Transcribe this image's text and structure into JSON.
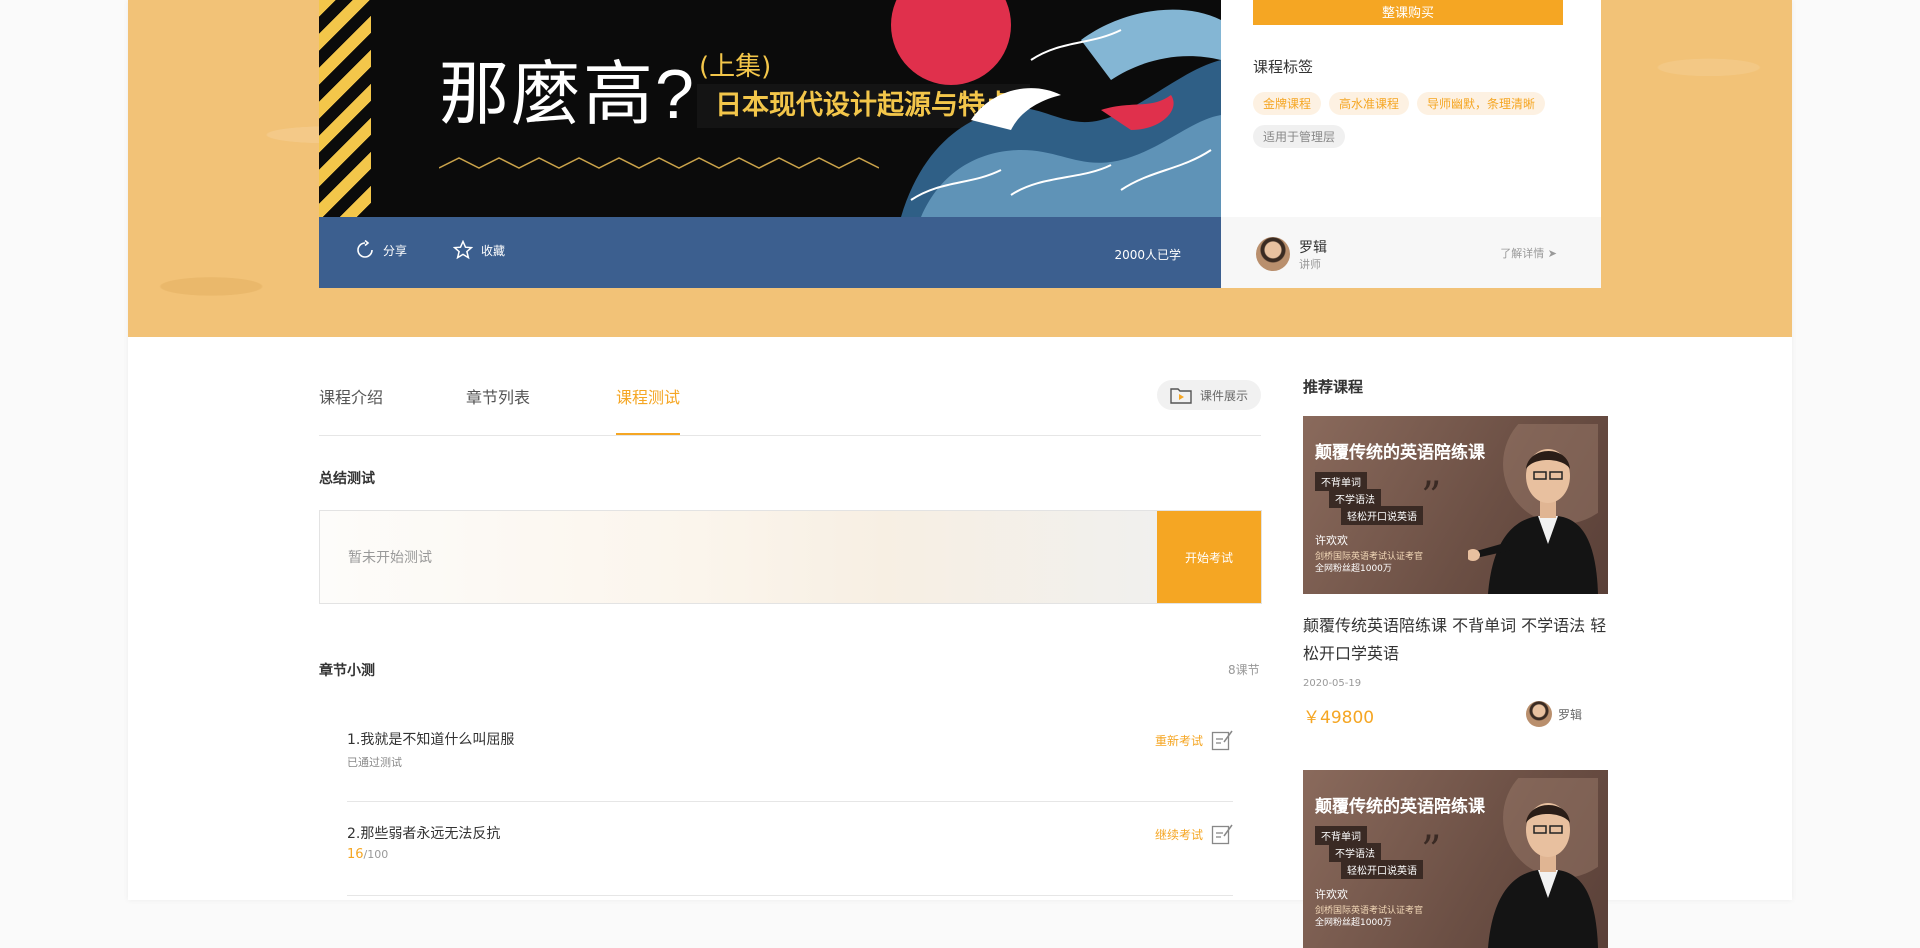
{
  "hero": {
    "banner": {
      "headline": "那麼高?",
      "part": "(上集)",
      "subtitle": "日本现代设计起源与特点"
    },
    "actions": {
      "share": "分享",
      "favorite": "收藏",
      "learners": "2000人已学"
    },
    "buy_button": "整课购买",
    "tags_title": "课程标签",
    "tags": [
      "金牌课程",
      "高水准课程",
      "导师幽默，条理清晰",
      "适用于管理层"
    ],
    "lecturer": {
      "name": "罗辑",
      "role": "讲师",
      "more": "了解详情 ➤"
    }
  },
  "tabs": [
    "课程介绍",
    "章节列表",
    "课程测试"
  ],
  "active_tab": "课程测试",
  "courseware_button": "课件展示",
  "summary": {
    "title": "总结测试",
    "status": "暂未开始测试",
    "start_button": "开始考试"
  },
  "chapter": {
    "title": "章节小测",
    "count": "8课节",
    "items": [
      {
        "title": "1.我就是不知道什么叫屈服",
        "status": "已通过测试",
        "action": "重新考试"
      },
      {
        "title": "2.那些弱者永远无法反抗",
        "score": "16",
        "total": "/100",
        "action": "继续考试"
      }
    ]
  },
  "recommend": {
    "title": "推荐课程",
    "courses": [
      {
        "image": {
          "title": "颠覆传统的英语陪练课",
          "chips": [
            "不背单词",
            "不学语法",
            "轻松开口说英语"
          ],
          "name": "许欢欢",
          "line1": "剑桥国际英语考试认证考官",
          "line2": "全网粉丝超1000万"
        },
        "name": "颠覆传统英语陪练课  不背单词   不学语法   轻松开口学英语",
        "date": "2020-05-19",
        "price": "￥49800",
        "teacher": "罗辑"
      },
      {
        "image": {
          "title": "颠覆传统的英语陪练课",
          "chips": [
            "不背单词",
            "不学语法",
            "轻松开口说英语"
          ],
          "name": "许欢欢",
          "line1": "剑桥国际英语考试认证考官",
          "line2": "全网粉丝超1000万"
        }
      }
    ]
  },
  "colors": {
    "accent": "#f5a623",
    "hero_bg": "#f2c277",
    "action_bar": "#3c5f8f",
    "banner_bg": "#0b0b0b"
  }
}
